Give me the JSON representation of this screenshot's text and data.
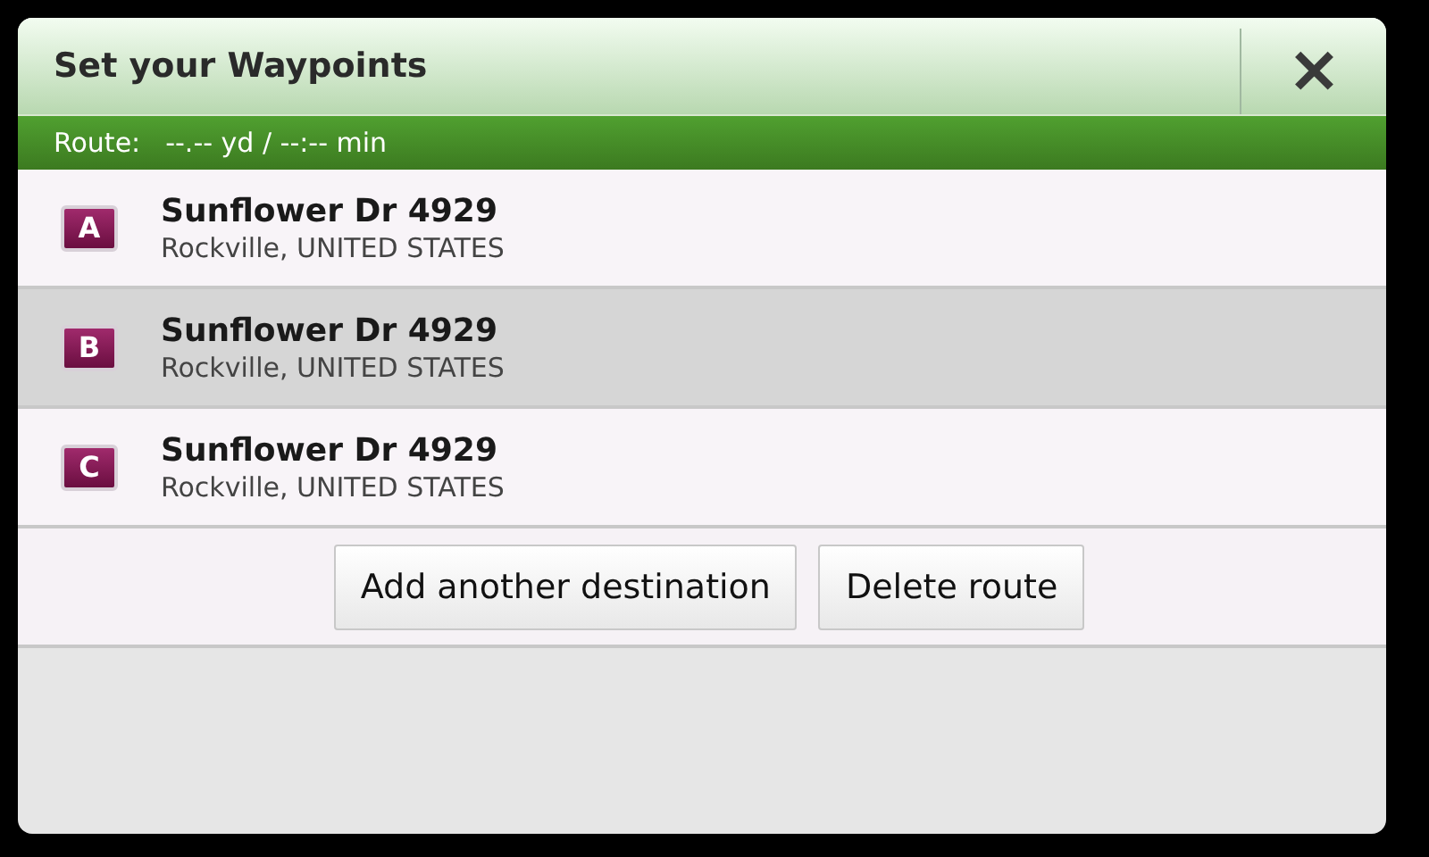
{
  "window": {
    "title": "Set your Waypoints",
    "close_label": "✕"
  },
  "route": {
    "label": "Route:",
    "value": "--.-- yd / --:-- min"
  },
  "waypoints": [
    {
      "marker": "A",
      "street": "Sunflower Dr 4929",
      "place": "Rockville, UNITED STATES",
      "selected": false
    },
    {
      "marker": "B",
      "street": "Sunflower Dr 4929",
      "place": "Rockville, UNITED STATES",
      "selected": true
    },
    {
      "marker": "C",
      "street": "Sunflower Dr 4929",
      "place": "Rockville, UNITED STATES",
      "selected": false
    }
  ],
  "buttons": [
    "Add another destination",
    "Delete route"
  ]
}
